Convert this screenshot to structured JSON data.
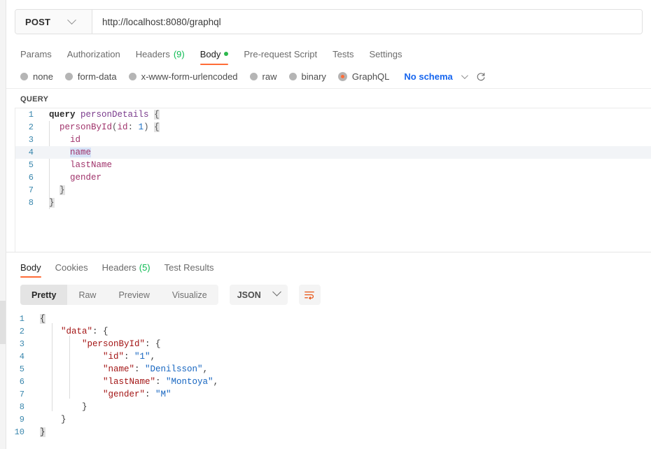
{
  "request": {
    "method": "POST",
    "url": "http://localhost:8080/graphql",
    "tabs": [
      {
        "label": "Params",
        "count": "",
        "active": false,
        "dot": false
      },
      {
        "label": "Authorization",
        "count": "",
        "active": false,
        "dot": false
      },
      {
        "label": "Headers",
        "count": "(9)",
        "active": false,
        "dot": false
      },
      {
        "label": "Body",
        "count": "",
        "active": true,
        "dot": true
      },
      {
        "label": "Pre-request Script",
        "count": "",
        "active": false,
        "dot": false
      },
      {
        "label": "Tests",
        "count": "",
        "active": false,
        "dot": false
      },
      {
        "label": "Settings",
        "count": "",
        "active": false,
        "dot": false
      }
    ],
    "body_types": [
      {
        "label": "none",
        "selected": false
      },
      {
        "label": "form-data",
        "selected": false
      },
      {
        "label": "x-www-form-urlencoded",
        "selected": false
      },
      {
        "label": "raw",
        "selected": false
      },
      {
        "label": "binary",
        "selected": false
      },
      {
        "label": "GraphQL",
        "selected": true
      }
    ],
    "schema_label": "No schema",
    "query_label": "QUERY",
    "query_lines": [
      {
        "n": "1",
        "tokens": [
          {
            "t": "query",
            "c": "t-kw"
          },
          {
            "t": " ",
            "c": "t-pun"
          },
          {
            "t": "personDetails",
            "c": "t-name"
          },
          {
            "t": " ",
            "c": "t-pun"
          },
          {
            "t": "{",
            "c": "t-brk"
          }
        ],
        "highlight": false
      },
      {
        "n": "2",
        "tokens": [
          {
            "t": "  ",
            "c": "t-pun"
          },
          {
            "t": "personById",
            "c": "t-fld"
          },
          {
            "t": "(",
            "c": "t-pun"
          },
          {
            "t": "id",
            "c": "t-arg"
          },
          {
            "t": ": ",
            "c": "t-pun"
          },
          {
            "t": "1",
            "c": "t-num"
          },
          {
            "t": ")",
            "c": "t-pun"
          },
          {
            "t": " ",
            "c": "t-pun"
          },
          {
            "t": "{",
            "c": "t-brk"
          }
        ],
        "highlight": false
      },
      {
        "n": "3",
        "tokens": [
          {
            "t": "    ",
            "c": "t-pun"
          },
          {
            "t": "id",
            "c": "t-fld"
          }
        ],
        "highlight": false
      },
      {
        "n": "4",
        "tokens": [
          {
            "t": "    ",
            "c": "t-pun"
          },
          {
            "t": "name",
            "c": "t-fld t-sel"
          }
        ],
        "highlight": true
      },
      {
        "n": "5",
        "tokens": [
          {
            "t": "    ",
            "c": "t-pun"
          },
          {
            "t": "lastName",
            "c": "t-fld"
          }
        ],
        "highlight": false
      },
      {
        "n": "6",
        "tokens": [
          {
            "t": "    ",
            "c": "t-pun"
          },
          {
            "t": "gender",
            "c": "t-fld"
          }
        ],
        "highlight": false
      },
      {
        "n": "7",
        "tokens": [
          {
            "t": "  ",
            "c": "t-pun"
          },
          {
            "t": "}",
            "c": "t-brk"
          }
        ],
        "highlight": false
      },
      {
        "n": "8",
        "tokens": [
          {
            "t": "}",
            "c": "t-brk"
          }
        ],
        "highlight": false
      }
    ]
  },
  "response": {
    "tabs": [
      {
        "label": "Body",
        "count": "",
        "active": true
      },
      {
        "label": "Cookies",
        "count": "",
        "active": false
      },
      {
        "label": "Headers",
        "count": "(5)",
        "active": false
      },
      {
        "label": "Test Results",
        "count": "",
        "active": false
      }
    ],
    "view_modes": [
      {
        "label": "Pretty",
        "active": true
      },
      {
        "label": "Raw",
        "active": false
      },
      {
        "label": "Preview",
        "active": false
      },
      {
        "label": "Visualize",
        "active": false
      }
    ],
    "format": "JSON",
    "body_lines": [
      {
        "n": "1",
        "tokens": [
          {
            "t": "{",
            "c": "j-brk"
          }
        ]
      },
      {
        "n": "2",
        "tokens": [
          {
            "t": "    ",
            "c": "j-pun"
          },
          {
            "t": "\"data\"",
            "c": "j-key"
          },
          {
            "t": ": {",
            "c": "j-pun"
          }
        ]
      },
      {
        "n": "3",
        "tokens": [
          {
            "t": "        ",
            "c": "j-pun"
          },
          {
            "t": "\"personById\"",
            "c": "j-key"
          },
          {
            "t": ": {",
            "c": "j-pun"
          }
        ]
      },
      {
        "n": "4",
        "tokens": [
          {
            "t": "            ",
            "c": "j-pun"
          },
          {
            "t": "\"id\"",
            "c": "j-key"
          },
          {
            "t": ": ",
            "c": "j-pun"
          },
          {
            "t": "\"1\"",
            "c": "j-str"
          },
          {
            "t": ",",
            "c": "j-pun"
          }
        ]
      },
      {
        "n": "5",
        "tokens": [
          {
            "t": "            ",
            "c": "j-pun"
          },
          {
            "t": "\"name\"",
            "c": "j-key"
          },
          {
            "t": ": ",
            "c": "j-pun"
          },
          {
            "t": "\"Denilsson\"",
            "c": "j-str"
          },
          {
            "t": ",",
            "c": "j-pun"
          }
        ]
      },
      {
        "n": "6",
        "tokens": [
          {
            "t": "            ",
            "c": "j-pun"
          },
          {
            "t": "\"lastName\"",
            "c": "j-key"
          },
          {
            "t": ": ",
            "c": "j-pun"
          },
          {
            "t": "\"Montoya\"",
            "c": "j-str"
          },
          {
            "t": ",",
            "c": "j-pun"
          }
        ]
      },
      {
        "n": "7",
        "tokens": [
          {
            "t": "            ",
            "c": "j-pun"
          },
          {
            "t": "\"gender\"",
            "c": "j-key"
          },
          {
            "t": ": ",
            "c": "j-pun"
          },
          {
            "t": "\"M\"",
            "c": "j-str"
          }
        ]
      },
      {
        "n": "8",
        "tokens": [
          {
            "t": "        ",
            "c": "j-pun"
          },
          {
            "t": "}",
            "c": "j-pun"
          }
        ]
      },
      {
        "n": "9",
        "tokens": [
          {
            "t": "    ",
            "c": "j-pun"
          },
          {
            "t": "}",
            "c": "j-pun"
          }
        ]
      },
      {
        "n": "10",
        "tokens": [
          {
            "t": "}",
            "c": "j-brk"
          }
        ]
      }
    ]
  },
  "colors": {
    "accent": "#ff6c37",
    "link": "#1565ef",
    "count_green": "#0cbb52",
    "json_key": "#a31515",
    "json_string": "#1565c0"
  }
}
